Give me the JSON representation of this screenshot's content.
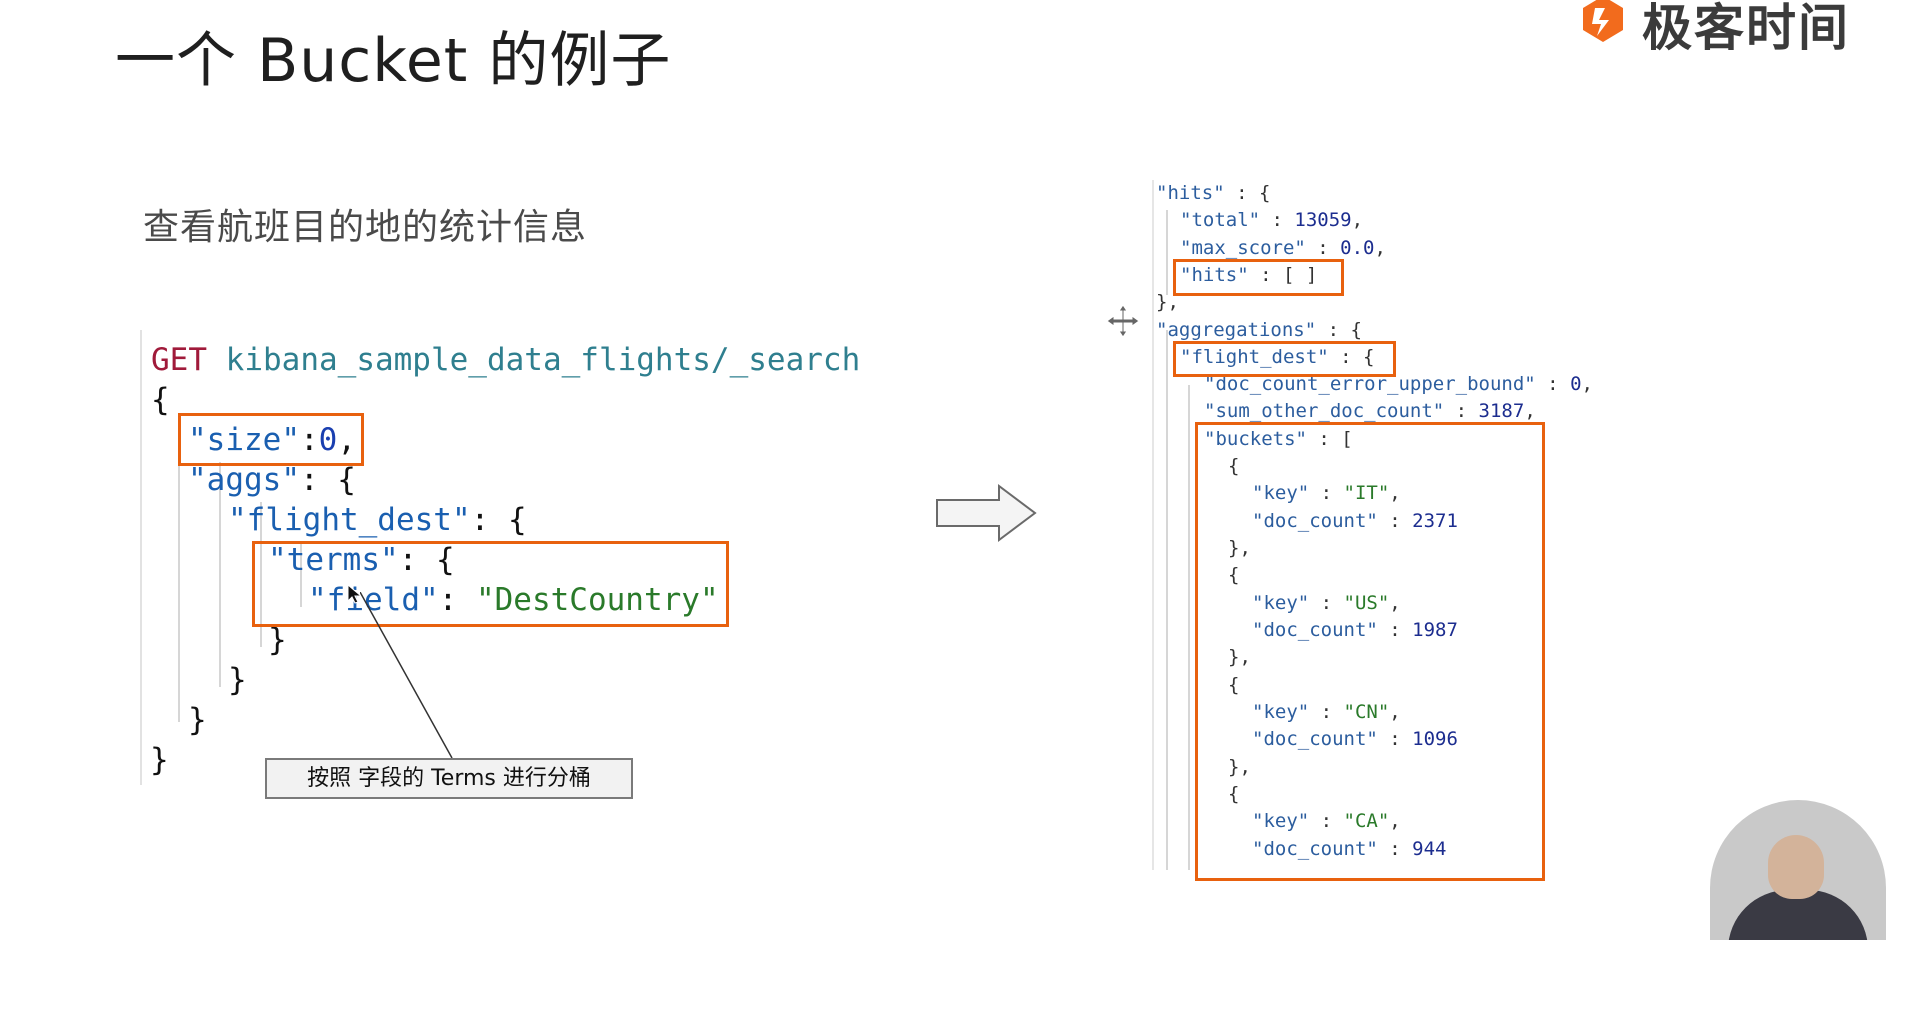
{
  "slide": {
    "title": "一个 Bucket 的例子",
    "subtitle": "查看航班目的地的统计信息"
  },
  "logo": {
    "text": "极客时间",
    "icon": "geektime-logo-icon",
    "accent": "#f26b1d"
  },
  "request": {
    "method": "GET",
    "path": "kibana_sample_data_flights/_search",
    "lines": [
      "{",
      "\"size\":0,",
      "\"aggs\": {",
      "\"flight_dest\": {",
      "\"terms\": {",
      "\"field\": \"DestCountry\"",
      "}",
      "}",
      "}",
      "}"
    ],
    "size_key": "\"size\"",
    "size_value": "0",
    "aggs_key": "\"aggs\"",
    "flight_dest_key": "\"flight_dest\"",
    "terms_key": "\"terms\"",
    "field_key": "\"field\"",
    "field_value": "\"DestCountry\""
  },
  "callout": {
    "text": "按照 字段的 Terms 进行分桶"
  },
  "arrow": {
    "icon": "right-arrow-icon"
  },
  "response": {
    "hits_key": "\"hits\"",
    "total_key": "\"total\"",
    "total_value": "13059",
    "max_score_key": "\"max_score\"",
    "max_score_value": "0.0",
    "inner_hits_key": "\"hits\"",
    "inner_hits_value": "[ ]",
    "aggregations_key": "\"aggregations\"",
    "flight_dest_key": "\"flight_dest\"",
    "error_bound_key": "\"doc_count_error_upper_bound\"",
    "error_bound_value": "0",
    "sum_other_key": "\"sum_other_doc_count\"",
    "sum_other_value": "3187",
    "buckets_key": "\"buckets\"",
    "buckets": [
      {
        "key": "\"IT\"",
        "doc_count": "2371"
      },
      {
        "key": "\"US\"",
        "doc_count": "1987"
      },
      {
        "key": "\"CN\"",
        "doc_count": "1096"
      },
      {
        "key": "\"CA\"",
        "doc_count": "944"
      }
    ]
  },
  "colors": {
    "highlight_box": "#e8610e",
    "keyword": "#a01a3a",
    "string_value": "#2a7a2a"
  }
}
